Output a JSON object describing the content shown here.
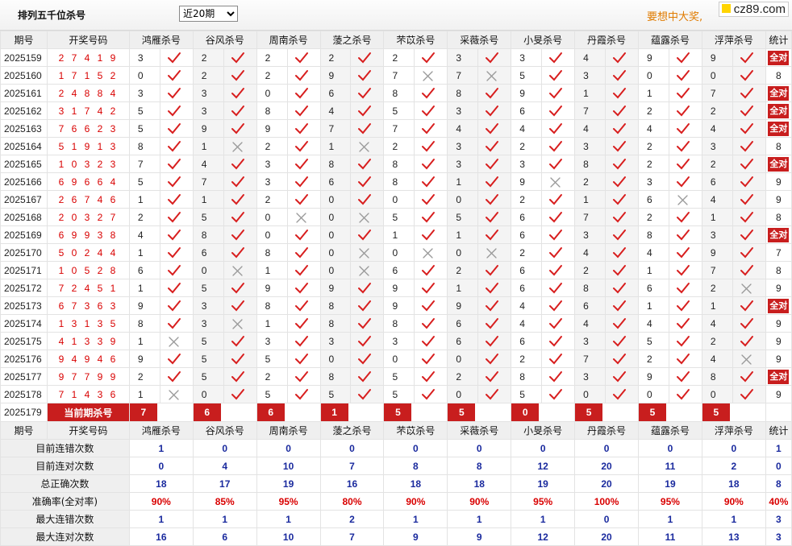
{
  "header": {
    "title": "排列五千位杀号",
    "period_options": [
      "近20期"
    ],
    "period_selected": "近20期",
    "promo": "要想中大奖,",
    "logo": "cz89.com"
  },
  "columns": {
    "issue": "期号",
    "numbers": "开奖号码",
    "experts": [
      "鸿雁杀号",
      "谷风杀号",
      "周南杀号",
      "蔆之杀号",
      "芣苡杀号",
      "采薇杀号",
      "小旻杀号",
      "丹霞杀号",
      "蕴露杀号",
      "浮萍杀号"
    ],
    "total": "统计"
  },
  "rows": [
    {
      "issue": "2025159",
      "numbers": "27419",
      "kills": [
        "3",
        "2",
        "2",
        "2",
        "2",
        "3",
        "3",
        "4",
        "9",
        "9"
      ],
      "marks": [
        1,
        1,
        1,
        1,
        1,
        1,
        1,
        1,
        1,
        1
      ],
      "total": "全对"
    },
    {
      "issue": "2025160",
      "numbers": "17152",
      "kills": [
        "0",
        "2",
        "2",
        "9",
        "7",
        "7",
        "5",
        "3",
        "0",
        "0"
      ],
      "marks": [
        1,
        1,
        1,
        1,
        0,
        0,
        1,
        1,
        1,
        1
      ],
      "total": "8"
    },
    {
      "issue": "2025161",
      "numbers": "24884",
      "kills": [
        "3",
        "3",
        "0",
        "6",
        "8",
        "8",
        "9",
        "1",
        "1",
        "7"
      ],
      "marks": [
        1,
        1,
        1,
        1,
        1,
        1,
        1,
        1,
        1,
        1
      ],
      "total": "全对"
    },
    {
      "issue": "2025162",
      "numbers": "31742",
      "kills": [
        "5",
        "3",
        "8",
        "4",
        "5",
        "3",
        "6",
        "7",
        "2",
        "2"
      ],
      "marks": [
        1,
        1,
        1,
        1,
        1,
        1,
        1,
        1,
        1,
        1
      ],
      "total": "全对"
    },
    {
      "issue": "2025163",
      "numbers": "76623",
      "kills": [
        "5",
        "9",
        "9",
        "7",
        "7",
        "4",
        "4",
        "4",
        "4",
        "4"
      ],
      "marks": [
        1,
        1,
        1,
        1,
        1,
        1,
        1,
        1,
        1,
        1
      ],
      "total": "全对"
    },
    {
      "issue": "2025164",
      "numbers": "51913",
      "kills": [
        "8",
        "1",
        "2",
        "1",
        "2",
        "3",
        "2",
        "3",
        "2",
        "3"
      ],
      "marks": [
        1,
        0,
        1,
        0,
        1,
        1,
        1,
        1,
        1,
        1
      ],
      "total": "8"
    },
    {
      "issue": "2025165",
      "numbers": "10323",
      "kills": [
        "7",
        "4",
        "3",
        "8",
        "8",
        "3",
        "3",
        "8",
        "2",
        "2"
      ],
      "marks": [
        1,
        1,
        1,
        1,
        1,
        1,
        1,
        1,
        1,
        1
      ],
      "total": "全对"
    },
    {
      "issue": "2025166",
      "numbers": "69664",
      "kills": [
        "5",
        "7",
        "3",
        "6",
        "8",
        "1",
        "9",
        "2",
        "3",
        "6"
      ],
      "marks": [
        1,
        1,
        1,
        1,
        1,
        1,
        0,
        1,
        1,
        1
      ],
      "total": "9"
    },
    {
      "issue": "2025167",
      "numbers": "26746",
      "kills": [
        "1",
        "1",
        "2",
        "0",
        "0",
        "0",
        "2",
        "1",
        "6",
        "4"
      ],
      "marks": [
        1,
        1,
        1,
        1,
        1,
        1,
        1,
        1,
        0,
        1
      ],
      "total": "9"
    },
    {
      "issue": "2025168",
      "numbers": "20327",
      "kills": [
        "2",
        "5",
        "0",
        "0",
        "5",
        "5",
        "6",
        "7",
        "2",
        "1"
      ],
      "marks": [
        1,
        1,
        0,
        0,
        1,
        1,
        1,
        1,
        1,
        1
      ],
      "total": "8"
    },
    {
      "issue": "2025169",
      "numbers": "69938",
      "kills": [
        "4",
        "8",
        "0",
        "0",
        "1",
        "1",
        "6",
        "3",
        "8",
        "3"
      ],
      "marks": [
        1,
        1,
        1,
        1,
        1,
        1,
        1,
        1,
        1,
        1
      ],
      "total": "全对"
    },
    {
      "issue": "2025170",
      "numbers": "50244",
      "kills": [
        "1",
        "6",
        "8",
        "0",
        "0",
        "0",
        "2",
        "4",
        "4",
        "9"
      ],
      "marks": [
        1,
        1,
        1,
        0,
        0,
        0,
        1,
        1,
        1,
        1
      ],
      "total": "7"
    },
    {
      "issue": "2025171",
      "numbers": "10528",
      "kills": [
        "6",
        "0",
        "1",
        "0",
        "6",
        "2",
        "6",
        "2",
        "1",
        "7"
      ],
      "marks": [
        1,
        0,
        1,
        0,
        1,
        1,
        1,
        1,
        1,
        1
      ],
      "total": "8"
    },
    {
      "issue": "2025172",
      "numbers": "72451",
      "kills": [
        "1",
        "5",
        "9",
        "9",
        "9",
        "1",
        "6",
        "8",
        "6",
        "2"
      ],
      "marks": [
        1,
        1,
        1,
        1,
        1,
        1,
        1,
        1,
        1,
        0
      ],
      "total": "9"
    },
    {
      "issue": "2025173",
      "numbers": "67363",
      "kills": [
        "9",
        "3",
        "8",
        "8",
        "9",
        "9",
        "4",
        "6",
        "1",
        "1"
      ],
      "marks": [
        1,
        1,
        1,
        1,
        1,
        1,
        1,
        1,
        1,
        1
      ],
      "total": "全对"
    },
    {
      "issue": "2025174",
      "numbers": "13135",
      "kills": [
        "8",
        "3",
        "1",
        "8",
        "8",
        "6",
        "4",
        "4",
        "4",
        "4"
      ],
      "marks": [
        1,
        0,
        1,
        1,
        1,
        1,
        1,
        1,
        1,
        1
      ],
      "total": "9"
    },
    {
      "issue": "2025175",
      "numbers": "41339",
      "kills": [
        "1",
        "5",
        "3",
        "3",
        "3",
        "6",
        "6",
        "3",
        "5",
        "2"
      ],
      "marks": [
        0,
        1,
        1,
        1,
        1,
        1,
        1,
        1,
        1,
        1
      ],
      "total": "9"
    },
    {
      "issue": "2025176",
      "numbers": "94946",
      "kills": [
        "9",
        "5",
        "5",
        "0",
        "0",
        "0",
        "2",
        "7",
        "2",
        "4"
      ],
      "marks": [
        1,
        1,
        1,
        1,
        1,
        1,
        1,
        1,
        1,
        0
      ],
      "total": "9"
    },
    {
      "issue": "2025177",
      "numbers": "97799",
      "kills": [
        "2",
        "5",
        "2",
        "8",
        "5",
        "2",
        "8",
        "3",
        "9",
        "8"
      ],
      "marks": [
        1,
        1,
        1,
        1,
        1,
        1,
        1,
        1,
        1,
        1
      ],
      "total": "全对"
    },
    {
      "issue": "2025178",
      "numbers": "71436",
      "kills": [
        "1",
        "0",
        "5",
        "5",
        "5",
        "0",
        "5",
        "0",
        "0",
        "0"
      ],
      "marks": [
        0,
        1,
        1,
        1,
        1,
        1,
        1,
        1,
        1,
        1
      ],
      "total": "9"
    }
  ],
  "current": {
    "issue": "2025179",
    "label": "当前期杀号",
    "kills": [
      "7",
      "6",
      "6",
      "1",
      "5",
      "5",
      "0",
      "5",
      "5",
      "5"
    ]
  },
  "stats": [
    {
      "label": "目前连错次数",
      "values": [
        "1",
        "0",
        "0",
        "0",
        "0",
        "0",
        "0",
        "0",
        "0",
        "0"
      ],
      "total": "1"
    },
    {
      "label": "目前连对次数",
      "values": [
        "0",
        "4",
        "10",
        "7",
        "8",
        "8",
        "12",
        "20",
        "11",
        "2"
      ],
      "total": "0"
    },
    {
      "label": "总正确次数",
      "values": [
        "18",
        "17",
        "19",
        "16",
        "18",
        "18",
        "19",
        "20",
        "19",
        "18"
      ],
      "total": "8"
    },
    {
      "label": "准确率(全对率)",
      "values": [
        "90%",
        "85%",
        "95%",
        "80%",
        "90%",
        "90%",
        "95%",
        "100%",
        "95%",
        "90%"
      ],
      "total": "40%"
    },
    {
      "label": "最大连错次数",
      "values": [
        "1",
        "1",
        "1",
        "2",
        "1",
        "1",
        "1",
        "0",
        "1",
        "1"
      ],
      "total": "3"
    },
    {
      "label": "最大连对次数",
      "values": [
        "16",
        "6",
        "10",
        "7",
        "9",
        "9",
        "12",
        "20",
        "11",
        "13"
      ],
      "total": "3"
    }
  ],
  "colors": {
    "accent_red": "#c81e1e",
    "check_red": "#d81e1e",
    "cross_gray": "#999999",
    "stat_blue": "#1a2a9e",
    "promo_orange": "#e07b00"
  }
}
